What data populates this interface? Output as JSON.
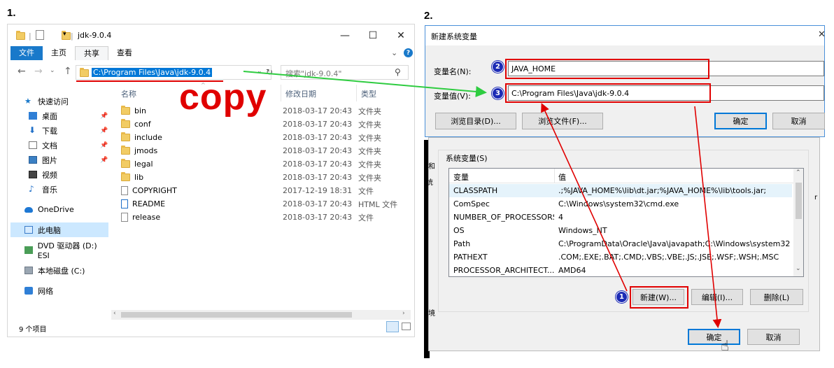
{
  "step1": "1.",
  "step2": "2.",
  "explorer": {
    "title": "jdk-9.0.4",
    "tabs": [
      "文件",
      "主页",
      "共享",
      "查看"
    ],
    "path": "C:\\Program Files\\Java\\jdk-9.0.4",
    "search_placeholder": "搜索\"jdk-9.0.4\"",
    "annotation": "copy",
    "columns": {
      "name": "名称",
      "date": "修改日期",
      "type": "类型"
    },
    "sidebar": [
      {
        "label": "快速访问",
        "icon": "star-icon"
      },
      {
        "label": "桌面",
        "icon": "desktop-icon"
      },
      {
        "label": "下载",
        "icon": "download-icon"
      },
      {
        "label": "文档",
        "icon": "document-icon"
      },
      {
        "label": "图片",
        "icon": "picture-icon"
      },
      {
        "label": "视频",
        "icon": "video-icon"
      },
      {
        "label": "音乐",
        "icon": "music-icon"
      },
      {
        "label": "OneDrive",
        "icon": "cloud-icon"
      },
      {
        "label": "此电脑",
        "icon": "computer-icon"
      },
      {
        "label": "DVD 驱动器 (D:) ESI",
        "icon": "dvd-icon"
      },
      {
        "label": "本地磁盘 (C:)",
        "icon": "disk-icon"
      },
      {
        "label": "网络",
        "icon": "network-icon"
      }
    ],
    "files": [
      {
        "name": "bin",
        "date": "2018-03-17 20:43",
        "type": "文件夹",
        "kind": "folder"
      },
      {
        "name": "conf",
        "date": "2018-03-17 20:43",
        "type": "文件夹",
        "kind": "folder"
      },
      {
        "name": "include",
        "date": "2018-03-17 20:43",
        "type": "文件夹",
        "kind": "folder"
      },
      {
        "name": "jmods",
        "date": "2018-03-17 20:43",
        "type": "文件夹",
        "kind": "folder"
      },
      {
        "name": "legal",
        "date": "2018-03-17 20:43",
        "type": "文件夹",
        "kind": "folder"
      },
      {
        "name": "lib",
        "date": "2018-03-17 20:43",
        "type": "文件夹",
        "kind": "folder"
      },
      {
        "name": "COPYRIGHT",
        "date": "2017-12-19 18:31",
        "type": "文件",
        "kind": "file"
      },
      {
        "name": "README",
        "date": "2018-03-17 20:43",
        "type": "HTML 文件",
        "kind": "html"
      },
      {
        "name": "release",
        "date": "2018-03-17 20:43",
        "type": "文件",
        "kind": "file"
      }
    ],
    "status": "9 个项目"
  },
  "new_var": {
    "title": "新建系统变量",
    "name_label": "变量名(N):",
    "name_value": "JAVA_HOME",
    "value_label": "变量值(V):",
    "value_value": "C:\\Program Files\\Java\\jdk-9.0.4",
    "browse_dir": "浏览目录(D)...",
    "browse_file": "浏览文件(F)...",
    "ok": "确定",
    "cancel": "取消"
  },
  "sysvars": {
    "group_label": "系统变量(S)",
    "col_var": "变量",
    "col_value": "值",
    "rows": [
      {
        "name": "CLASSPATH",
        "value": ".;%JAVA_HOME%\\lib\\dt.jar;%JAVA_HOME%\\lib\\tools.jar;"
      },
      {
        "name": "ComSpec",
        "value": "C:\\Windows\\system32\\cmd.exe"
      },
      {
        "name": "NUMBER_OF_PROCESSORS",
        "value": "4"
      },
      {
        "name": "OS",
        "value": "Windows_NT"
      },
      {
        "name": "Path",
        "value": "C:\\ProgramData\\Oracle\\Java\\javapath;C:\\Windows\\system32;..."
      },
      {
        "name": "PATHEXT",
        "value": ".COM;.EXE;.BAT;.CMD;.VBS;.VBE;.JS;.JSE;.WSF;.WSH;.MSC"
      },
      {
        "name": "PROCESSOR_ARCHITECT...",
        "value": "AMD64"
      }
    ],
    "new_btn": "新建(W)...",
    "edit_btn": "编辑(I)...",
    "delete_btn": "删除(L)",
    "ok": "确定",
    "cancel": "取消"
  },
  "badges": [
    "1",
    "2",
    "3"
  ],
  "bg_fragments": [
    "J和",
    "统",
    "r",
    "‘境"
  ],
  "colors": {
    "accent": "#0078d7",
    "annotation_red": "#e00000",
    "arrow_green": "#2ecc40",
    "badge_blue": "#1c2bb5"
  }
}
